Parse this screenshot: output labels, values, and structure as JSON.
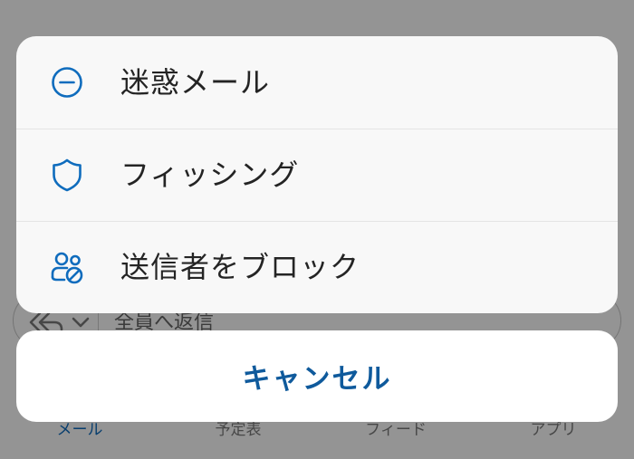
{
  "background": {
    "reply_bar": {
      "placeholder": "全員へ返信"
    },
    "tabs": [
      {
        "label": "メール",
        "active": true
      },
      {
        "label": "予定表",
        "active": false
      },
      {
        "label": "フィード",
        "active": false
      },
      {
        "label": "アプリ",
        "active": false
      }
    ]
  },
  "action_sheet": {
    "items": [
      {
        "icon": "minus-circle-icon",
        "label": "迷惑メール"
      },
      {
        "icon": "shield-icon",
        "label": "フィッシング"
      },
      {
        "icon": "block-sender-icon",
        "label": "送信者をブロック"
      }
    ],
    "cancel_label": "キャンセル"
  },
  "colors": {
    "accent": "#0f6cbd",
    "cancel_text": "#0f5a9c",
    "sheet_bg": "#f8f8f8",
    "overlay": "rgba(0,0,0,0.42)"
  }
}
